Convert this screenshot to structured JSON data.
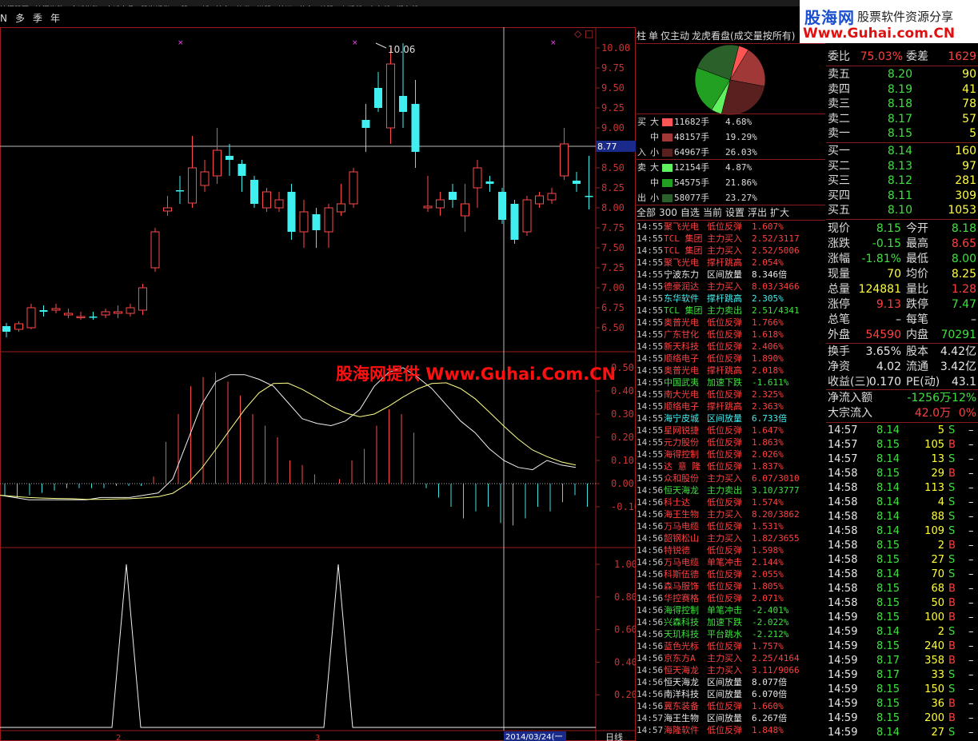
{
  "menu": [
    "沪深股票",
    "沪深指数",
    "全球指数",
    "全球商品",
    "股指期货",
    "B股",
    "三板",
    "基金",
    "债券",
    "港股",
    "外汇",
    "黄金",
    "美股",
    "上期所",
    "大商所",
    "郑商所"
  ],
  "logo": {
    "cn": "股海网",
    "slogan": "股票软件资源分享",
    "url": "Www.Guhai.com.CN"
  },
  "periods": [
    "N",
    "多",
    "季",
    "年"
  ],
  "watermark": "股海网提供 Www.Guhai.Com.CN",
  "chart_data": {
    "type": "candlestick",
    "price_axis": [
      "10.00",
      "9.75",
      "9.50",
      "9.25",
      "9.00",
      "8.75",
      "8.50",
      "8.25",
      "8.00",
      "7.75",
      "7.50",
      "7.25",
      "7.00",
      "6.75",
      "6.50"
    ],
    "high_label": "10.06",
    "cursor_price": "8.77",
    "macd_axis": [
      "0.50",
      "0.40",
      "0.30",
      "0.20",
      "0.10",
      "0.00",
      "-0.10"
    ],
    "signal_axis": [
      "1.00",
      "0.80",
      "0.60",
      "0.40",
      "0.20"
    ],
    "date_label": "2014/03/24(一",
    "period_label": "日线",
    "x_ticks": [
      "2",
      "3"
    ],
    "candles": [
      {
        "o": 6.45,
        "c": 6.52,
        "h": 6.56,
        "l": 6.38,
        "up": false
      },
      {
        "o": 6.48,
        "c": 6.55,
        "h": 6.58,
        "l": 6.45,
        "up": true
      },
      {
        "o": 6.5,
        "c": 6.75,
        "h": 6.8,
        "l": 6.48,
        "up": true
      },
      {
        "o": 6.7,
        "c": 6.72,
        "h": 6.78,
        "l": 6.64,
        "up": false
      },
      {
        "o": 6.74,
        "c": 6.72,
        "h": 6.8,
        "l": 6.68,
        "up": true
      },
      {
        "o": 6.68,
        "c": 6.66,
        "h": 6.74,
        "l": 6.62,
        "up": true
      },
      {
        "o": 6.64,
        "c": 6.64,
        "h": 6.7,
        "l": 6.6,
        "up": true
      },
      {
        "o": 6.64,
        "c": 6.64,
        "h": 6.7,
        "l": 6.6,
        "up": false
      },
      {
        "o": 6.66,
        "c": 6.7,
        "h": 6.74,
        "l": 6.62,
        "up": true
      },
      {
        "o": 6.7,
        "c": 6.68,
        "h": 6.78,
        "l": 6.62,
        "up": true
      },
      {
        "o": 6.68,
        "c": 6.75,
        "h": 6.8,
        "l": 6.64,
        "up": true
      },
      {
        "o": 6.72,
        "c": 7.0,
        "h": 7.05,
        "l": 6.66,
        "up": true
      },
      {
        "o": 7.25,
        "c": 7.7,
        "h": 7.75,
        "l": 7.2,
        "up": true
      },
      {
        "o": 7.96,
        "c": 8.0,
        "h": 8.15,
        "l": 7.9,
        "up": true
      },
      {
        "o": 8.22,
        "c": 8.22,
        "h": 8.4,
        "l": 8.05,
        "up": false
      },
      {
        "o": 8.06,
        "c": 8.5,
        "h": 8.9,
        "l": 8.0,
        "up": true
      },
      {
        "o": 8.28,
        "c": 8.45,
        "h": 8.6,
        "l": 8.2,
        "up": true
      },
      {
        "o": 8.4,
        "c": 8.72,
        "h": 9.0,
        "l": 8.3,
        "up": true
      },
      {
        "o": 8.65,
        "c": 8.6,
        "h": 8.8,
        "l": 8.4,
        "up": false
      },
      {
        "o": 8.55,
        "c": 8.4,
        "h": 8.6,
        "l": 8.2,
        "up": false
      },
      {
        "o": 8.35,
        "c": 8.05,
        "h": 8.4,
        "l": 8.0,
        "up": false
      },
      {
        "o": 8.0,
        "c": 8.2,
        "h": 8.25,
        "l": 7.95,
        "up": true
      },
      {
        "o": 8.0,
        "c": 8.1,
        "h": 8.2,
        "l": 7.95,
        "up": true
      },
      {
        "o": 8.2,
        "c": 7.7,
        "h": 8.3,
        "l": 7.6,
        "up": false
      },
      {
        "o": 7.7,
        "c": 7.95,
        "h": 8.1,
        "l": 7.5,
        "up": true
      },
      {
        "o": 7.92,
        "c": 7.72,
        "h": 8.0,
        "l": 7.5,
        "up": false
      },
      {
        "o": 7.7,
        "c": 8.0,
        "h": 8.05,
        "l": 7.5,
        "up": true
      },
      {
        "o": 7.95,
        "c": 8.05,
        "h": 8.3,
        "l": 7.9,
        "up": true
      },
      {
        "o": 8.05,
        "c": 8.45,
        "h": 8.5,
        "l": 8.0,
        "up": true
      },
      {
        "o": 9.1,
        "c": 9.0,
        "h": 9.3,
        "l": 8.7,
        "up": false
      },
      {
        "o": 9.25,
        "c": 9.5,
        "h": 9.7,
        "l": 9.2,
        "up": false
      },
      {
        "o": 9.0,
        "c": 9.8,
        "h": 10.0,
        "l": 8.8,
        "up": true
      },
      {
        "o": 9.4,
        "c": 9.2,
        "h": 10.06,
        "l": 9.0,
        "up": false
      },
      {
        "o": 9.3,
        "c": 8.7,
        "h": 9.6,
        "l": 8.5,
        "up": false
      },
      {
        "o": 8.0,
        "c": 8.02,
        "h": 8.4,
        "l": 7.95,
        "up": true
      },
      {
        "o": 8.1,
        "c": 8.0,
        "h": 8.2,
        "l": 7.9,
        "up": true
      },
      {
        "o": 8.2,
        "c": 8.1,
        "h": 8.3,
        "l": 8.0,
        "up": false
      },
      {
        "o": 7.9,
        "c": 8.05,
        "h": 8.3,
        "l": 7.7,
        "up": true
      },
      {
        "o": 8.25,
        "c": 8.5,
        "h": 8.6,
        "l": 8.0,
        "up": true
      },
      {
        "o": 8.33,
        "c": 8.3,
        "h": 8.4,
        "l": 8.2,
        "up": false
      },
      {
        "o": 8.2,
        "c": 7.85,
        "h": 8.25,
        "l": 7.8,
        "up": false
      },
      {
        "o": 8.05,
        "c": 7.6,
        "h": 8.1,
        "l": 7.55,
        "up": false
      },
      {
        "o": 7.7,
        "c": 8.1,
        "h": 8.15,
        "l": 7.65,
        "up": true
      },
      {
        "o": 8.05,
        "c": 8.15,
        "h": 8.2,
        "l": 8.0,
        "up": true
      },
      {
        "o": 8.1,
        "c": 8.18,
        "h": 8.25,
        "l": 8.05,
        "up": true
      },
      {
        "o": 8.4,
        "c": 8.8,
        "h": 9.0,
        "l": 8.35,
        "up": true
      },
      {
        "o": 8.34,
        "c": 8.3,
        "h": 8.45,
        "l": 8.2,
        "up": false
      },
      {
        "o": 8.14,
        "c": 8.15,
        "h": 8.65,
        "l": 7.98,
        "up": false
      }
    ],
    "macd_hist": [
      -0.05,
      -0.06,
      -0.05,
      -0.04,
      -0.03,
      -0.02,
      -0.02,
      -0.02,
      -0.02,
      -0.01,
      -0.01,
      -0.01,
      0.03,
      0.18,
      0.3,
      0.42,
      0.46,
      0.48,
      0.44,
      0.38,
      0.3,
      0.25,
      0.2,
      0.1,
      0.08,
      0.04,
      0.0,
      0.02,
      0.1,
      0.15,
      0.25,
      0.32,
      0.3,
      0.22,
      -0.02,
      -0.06,
      -0.1,
      -0.15,
      -0.12,
      -0.1,
      -0.17,
      -0.18,
      -0.15,
      -0.1,
      -0.12,
      -0.08,
      -0.05,
      -0.1
    ],
    "dif": [
      -0.05,
      -0.06,
      -0.07,
      -0.07,
      -0.07,
      -0.07,
      -0.07,
      -0.06,
      -0.06,
      -0.06,
      -0.05,
      -0.04,
      0.02,
      0.18,
      0.34,
      0.44,
      0.47,
      0.47,
      0.45,
      0.42,
      0.35,
      0.28,
      0.26,
      0.25,
      0.27,
      0.32,
      0.42,
      0.48,
      0.5,
      0.46,
      0.41,
      0.34,
      0.27,
      0.22,
      0.15,
      0.1,
      0.07,
      0.06,
      0.1,
      0.08,
      0.07
    ]
  },
  "tabs": [
    "柱",
    "单",
    "仅主动",
    "龙虎看盘(成交量按所有)"
  ],
  "pie": [
    {
      "pct": 4.68,
      "color": "#ff5555"
    },
    {
      "pct": 19.29,
      "color": "#a03838"
    },
    {
      "pct": 26.03,
      "color": "#5a2020"
    },
    {
      "pct": 4.87,
      "color": "#60f060"
    },
    {
      "pct": 21.86,
      "color": "#22a022"
    },
    {
      "pct": 23.27,
      "color": "#2a602a"
    }
  ],
  "flow": {
    "buy_label": [
      "买",
      "入"
    ],
    "sell_label": [
      "卖",
      "出"
    ],
    "sizes": [
      "大",
      "中",
      "小"
    ],
    "buy": [
      {
        "vol": "11682手",
        "pct": "4.68%",
        "color": "#ff5555"
      },
      {
        "vol": "48157手",
        "pct": "19.29%",
        "color": "#a03838"
      },
      {
        "vol": "64967手",
        "pct": "26.03%",
        "color": "#5a2020"
      }
    ],
    "sell": [
      {
        "vol": "12154手",
        "pct": "4.87%",
        "color": "#60f060"
      },
      {
        "vol": "54575手",
        "pct": "21.86%",
        "color": "#22a022"
      },
      {
        "vol": "58077手",
        "pct": "23.27%",
        "color": "#2a602a"
      }
    ]
  },
  "actions": [
    "全部",
    "300",
    "自选",
    "当前",
    "设置",
    "浮出",
    "扩大"
  ],
  "stream": [
    {
      "t": "14:55",
      "n": "聚飞光电",
      "s": "低位反弹",
      "v": "1.607%",
      "c": "red"
    },
    {
      "t": "14:55",
      "n": "TCL 集团",
      "s": "主力买入",
      "v": "2.52/3117",
      "c": "red"
    },
    {
      "t": "14:55",
      "n": "TCL 集团",
      "s": "主力买入",
      "v": "2.52/5006",
      "c": "red"
    },
    {
      "t": "14:55",
      "n": "聚飞光电",
      "s": "撑杆跳高",
      "v": "2.054%",
      "c": "red"
    },
    {
      "t": "14:55",
      "n": "宁波东力",
      "s": "区间放量",
      "v": "8.346倍",
      "c": "wht"
    },
    {
      "t": "14:55",
      "n": "德豪润达",
      "s": "主力买入",
      "v": "8.03/3466",
      "c": "red"
    },
    {
      "t": "14:55",
      "n": "东华软件",
      "s": "撑杆跳高",
      "v": "2.305%",
      "c": "cyn"
    },
    {
      "t": "14:55",
      "n": "TCL 集团",
      "s": "主力卖出",
      "v": "2.51/4341",
      "c": "grn"
    },
    {
      "t": "14:55",
      "n": "奥普光电",
      "s": "低位反弹",
      "v": "1.766%",
      "c": "red"
    },
    {
      "t": "14:55",
      "n": "广东甘化",
      "s": "低位反弹",
      "v": "1.618%",
      "c": "red"
    },
    {
      "t": "14:55",
      "n": "新天科技",
      "s": "低位反弹",
      "v": "2.406%",
      "c": "red"
    },
    {
      "t": "14:55",
      "n": "顺络电子",
      "s": "低位反弹",
      "v": "1.890%",
      "c": "red"
    },
    {
      "t": "14:55",
      "n": "奥普光电",
      "s": "撑杆跳高",
      "v": "2.018%",
      "c": "red"
    },
    {
      "t": "14:55",
      "n": "中国武夷",
      "s": "加速下跌",
      "v": "-1.611%",
      "c": "grn"
    },
    {
      "t": "14:55",
      "n": "南大光电",
      "s": "低位反弹",
      "v": "2.325%",
      "c": "red"
    },
    {
      "t": "14:55",
      "n": "顺络电子",
      "s": "撑杆跳高",
      "v": "2.363%",
      "c": "red"
    },
    {
      "t": "14:55",
      "n": "海宁皮城",
      "s": "区间放量",
      "v": "6.733倍",
      "c": "cyn"
    },
    {
      "t": "14:55",
      "n": "星网锐捷",
      "s": "低位反弹",
      "v": "1.647%",
      "c": "red"
    },
    {
      "t": "14:55",
      "n": "元力股份",
      "s": "低位反弹",
      "v": "1.863%",
      "c": "red"
    },
    {
      "t": "14:55",
      "n": "海得控制",
      "s": "低位反弹",
      "v": "2.026%",
      "c": "red"
    },
    {
      "t": "14:55",
      "n": "达 意 隆",
      "s": "低位反弹",
      "v": "1.837%",
      "c": "red"
    },
    {
      "t": "14:55",
      "n": "众和股份",
      "s": "主力买入",
      "v": "6.07/3010",
      "c": "red"
    },
    {
      "t": "14:56",
      "n": "恒天海龙",
      "s": "主力卖出",
      "v": "3.10/3777",
      "c": "grn"
    },
    {
      "t": "14:56",
      "n": "科士达",
      "s": "低位反弹",
      "v": "1.574%",
      "c": "red"
    },
    {
      "t": "14:56",
      "n": "海王生物",
      "s": "主力买入",
      "v": "8.20/3862",
      "c": "red"
    },
    {
      "t": "14:56",
      "n": "万马电缆",
      "s": "低位反弹",
      "v": "1.531%",
      "c": "red"
    },
    {
      "t": "14:56",
      "n": "韶钢松山",
      "s": "主力买入",
      "v": "1.82/3655",
      "c": "red"
    },
    {
      "t": "14:56",
      "n": "特锐德",
      "s": "低位反弹",
      "v": "1.598%",
      "c": "red"
    },
    {
      "t": "14:56",
      "n": "万马电缆",
      "s": "单笔冲击",
      "v": "2.144%",
      "c": "red"
    },
    {
      "t": "14:56",
      "n": "科斯伍德",
      "s": "低位反弹",
      "v": "2.055%",
      "c": "red"
    },
    {
      "t": "14:56",
      "n": "森马服饰",
      "s": "低位反弹",
      "v": "1.805%",
      "c": "red"
    },
    {
      "t": "14:56",
      "n": "华控赛格",
      "s": "低位反弹",
      "v": "2.071%",
      "c": "red"
    },
    {
      "t": "14:56",
      "n": "海得控制",
      "s": "单笔冲击",
      "v": "-2.401%",
      "c": "grn"
    },
    {
      "t": "14:56",
      "n": "兴森科技",
      "s": "加速下跌",
      "v": "-2.022%",
      "c": "grn"
    },
    {
      "t": "14:56",
      "n": "天玑科技",
      "s": "平台跳水",
      "v": "-2.212%",
      "c": "grn"
    },
    {
      "t": "14:56",
      "n": "蓝色光标",
      "s": "低位反弹",
      "v": "1.757%",
      "c": "red"
    },
    {
      "t": "14:56",
      "n": "京东方A",
      "s": "主力买入",
      "v": "2.25/4164",
      "c": "red"
    },
    {
      "t": "14:56",
      "n": "恒天海龙",
      "s": "主力买入",
      "v": "3.11/9066",
      "c": "red"
    },
    {
      "t": "14:56",
      "n": "恒天海龙",
      "s": "区间放量",
      "v": "8.077倍",
      "c": "wht"
    },
    {
      "t": "14:56",
      "n": "南洋科技",
      "s": "区间放量",
      "v": "6.070倍",
      "c": "wht"
    },
    {
      "t": "14:56",
      "n": "冀东装备",
      "s": "低位反弹",
      "v": "1.660%",
      "c": "red"
    },
    {
      "t": "14:57",
      "n": "海王生物",
      "s": "区间放量",
      "v": "6.267倍",
      "c": "wht"
    },
    {
      "t": "14:57",
      "n": "海隆软件",
      "s": "低位反弹",
      "v": "1.848%",
      "c": "red"
    }
  ],
  "quote": {
    "weibi": {
      "k": "委比",
      "v": "75.03%",
      "k2": "委差",
      "v2": "1629"
    },
    "asks": [
      {
        "k": "卖五",
        "p": "8.20",
        "v": "90"
      },
      {
        "k": "卖四",
        "p": "8.19",
        "v": "41"
      },
      {
        "k": "卖三",
        "p": "8.18",
        "v": "78"
      },
      {
        "k": "卖二",
        "p": "8.17",
        "v": "57"
      },
      {
        "k": "卖一",
        "p": "8.15",
        "v": "5"
      }
    ],
    "bids": [
      {
        "k": "买一",
        "p": "8.14",
        "v": "160"
      },
      {
        "k": "买二",
        "p": "8.13",
        "v": "97"
      },
      {
        "k": "买三",
        "p": "8.12",
        "v": "281"
      },
      {
        "k": "买四",
        "p": "8.11",
        "v": "309"
      },
      {
        "k": "买五",
        "p": "8.10",
        "v": "1053"
      }
    ],
    "stats": [
      {
        "k": "现价",
        "v": "8.15",
        "c": "grn",
        "k2": "今开",
        "v2": "8.18",
        "c2": "grn"
      },
      {
        "k": "涨跌",
        "v": "-0.15",
        "c": "grn",
        "k2": "最高",
        "v2": "8.65",
        "c2": "red"
      },
      {
        "k": "涨幅",
        "v": "-1.81%",
        "c": "grn",
        "k2": "最低",
        "v2": "8.00",
        "c2": "grn"
      },
      {
        "k": "现量",
        "v": "70",
        "c": "yel",
        "k2": "均价",
        "v2": "8.25",
        "c2": "yel"
      },
      {
        "k": "总量",
        "v": "124881",
        "c": "yel",
        "k2": "量比",
        "v2": "1.28",
        "c2": "red"
      },
      {
        "k": "涨停",
        "v": "9.13",
        "c": "red",
        "k2": "跌停",
        "v2": "7.47",
        "c2": "grn"
      },
      {
        "k": "总笔",
        "v": "–",
        "c": "wht",
        "k2": "每笔",
        "v2": "–",
        "c2": "wht"
      },
      {
        "k": "外盘",
        "v": "54590",
        "c": "red",
        "k2": "内盘",
        "v2": "70291",
        "c2": "grn"
      }
    ],
    "fin": [
      {
        "k": "换手",
        "v": "3.65%",
        "c": "wht",
        "k2": "股本",
        "v2": "4.42亿",
        "c2": "wht"
      },
      {
        "k": "净资",
        "v": "4.02",
        "c": "wht",
        "k2": "流通",
        "v2": "3.42亿",
        "c2": "wht"
      },
      {
        "k": "收益(三)",
        "v": "0.170",
        "c": "wht",
        "k2": "PE(动)",
        "v2": "43.1",
        "c2": "wht"
      }
    ],
    "netflow": {
      "k": "净流入额",
      "v": "-1256万",
      "v2": "-12%"
    },
    "bigflow": {
      "k": "大宗流入",
      "v": "42.0万",
      "v2": "0%"
    },
    "ticks": [
      {
        "t": "14:57",
        "p": "8.14",
        "q": "5",
        "d": "S"
      },
      {
        "t": "14:57",
        "p": "8.15",
        "q": "105",
        "d": "B"
      },
      {
        "t": "14:57",
        "p": "8.14",
        "q": "13",
        "d": "S"
      },
      {
        "t": "14:58",
        "p": "8.15",
        "q": "29",
        "d": "B"
      },
      {
        "t": "14:58",
        "p": "8.14",
        "q": "113",
        "d": "S"
      },
      {
        "t": "14:58",
        "p": "8.14",
        "q": "4",
        "d": "S"
      },
      {
        "t": "14:58",
        "p": "8.14",
        "q": "88",
        "d": "S"
      },
      {
        "t": "14:58",
        "p": "8.14",
        "q": "109",
        "d": "S"
      },
      {
        "t": "14:58",
        "p": "8.15",
        "q": "2",
        "d": "B"
      },
      {
        "t": "14:58",
        "p": "8.15",
        "q": "27",
        "d": "S"
      },
      {
        "t": "14:58",
        "p": "8.14",
        "q": "70",
        "d": "S"
      },
      {
        "t": "14:58",
        "p": "8.15",
        "q": "68",
        "d": "B"
      },
      {
        "t": "14:58",
        "p": "8.15",
        "q": "50",
        "d": "B"
      },
      {
        "t": "14:59",
        "p": "8.15",
        "q": "100",
        "d": "B"
      },
      {
        "t": "14:59",
        "p": "8.14",
        "q": "2",
        "d": "S"
      },
      {
        "t": "14:59",
        "p": "8.15",
        "q": "240",
        "d": "B"
      },
      {
        "t": "14:59",
        "p": "8.17",
        "q": "358",
        "d": "B"
      },
      {
        "t": "14:59",
        "p": "8.17",
        "q": "33",
        "d": "S"
      },
      {
        "t": "14:59",
        "p": "8.15",
        "q": "150",
        "d": "S"
      },
      {
        "t": "14:59",
        "p": "8.15",
        "q": "36",
        "d": "B"
      },
      {
        "t": "14:59",
        "p": "8.15",
        "q": "200",
        "d": "B"
      },
      {
        "t": "14:59",
        "p": "8.14",
        "q": "27",
        "d": "S"
      }
    ],
    "dash": "–"
  }
}
